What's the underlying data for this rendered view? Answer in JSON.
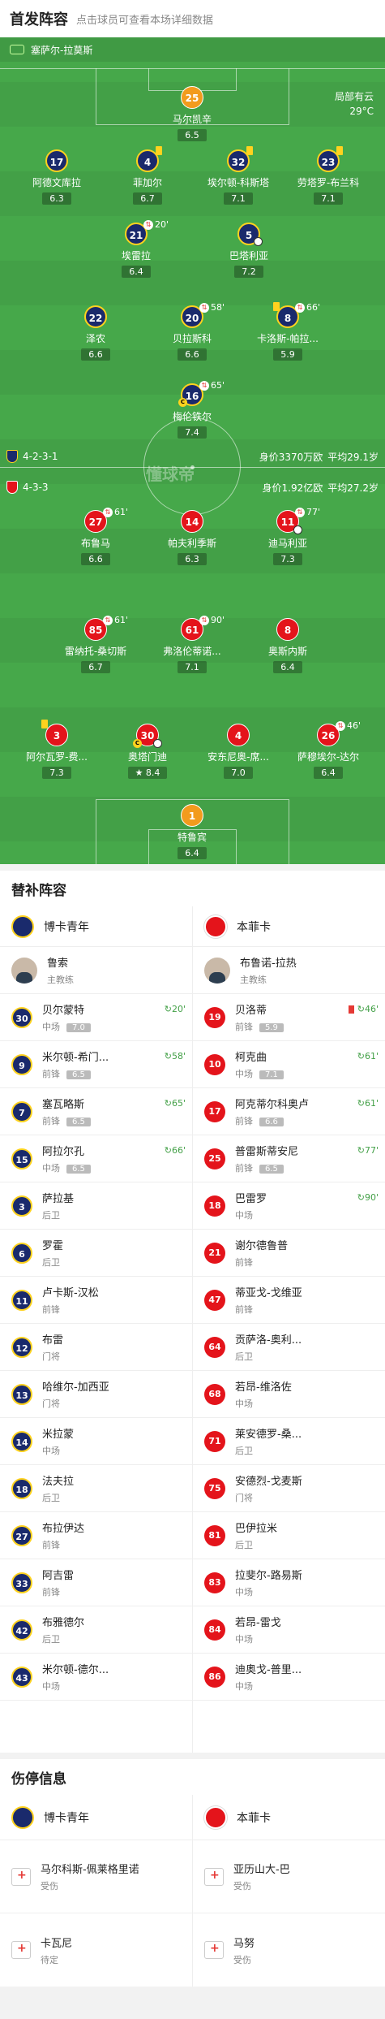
{
  "header": {
    "title": "首发阵容",
    "subtitle": "点击球员可查看本场详细数据"
  },
  "venue": "塞萨尔-拉莫斯",
  "weather": {
    "cond": "局部有云",
    "temp": "29°C"
  },
  "home": {
    "formation": "4-2-3-1",
    "value": "身价3370万欧",
    "age": "平均29.1岁"
  },
  "away": {
    "formation": "4-3-3",
    "value": "身价1.92亿欧",
    "age": "平均27.2岁"
  },
  "watermark": "懂球帝",
  "players": [
    {
      "num": "25",
      "name": "马尔凯辛",
      "rating": "6.5"
    },
    {
      "num": "17",
      "name": "阿德文库拉",
      "rating": "6.3"
    },
    {
      "num": "4",
      "name": "菲加尔",
      "rating": "6.7"
    },
    {
      "num": "32",
      "name": "埃尔顿-科斯塔",
      "rating": "7.1"
    },
    {
      "num": "23",
      "name": "劳塔罗-布兰科",
      "rating": "7.1"
    },
    {
      "num": "21",
      "name": "埃雷拉",
      "rating": "6.4",
      "sub": "20'"
    },
    {
      "num": "5",
      "name": "巴塔利亚",
      "rating": "7.2"
    },
    {
      "num": "22",
      "name": "泽农",
      "rating": "6.6"
    },
    {
      "num": "20",
      "name": "贝拉斯科",
      "rating": "6.6",
      "sub": "58'"
    },
    {
      "num": "8",
      "name": "卡洛斯-帕拉...",
      "rating": "5.9",
      "sub": "66'"
    },
    {
      "num": "16",
      "name": "梅伦铁尔",
      "rating": "7.4",
      "sub": "65'"
    },
    {
      "num": "27",
      "name": "布鲁马",
      "rating": "6.6",
      "sub": "61'"
    },
    {
      "num": "14",
      "name": "帕夫利季斯",
      "rating": "6.3"
    },
    {
      "num": "11",
      "name": "迪马利亚",
      "rating": "7.3",
      "sub": "77'"
    },
    {
      "num": "85",
      "name": "雷纳托-桑切斯",
      "rating": "6.7",
      "sub": "61'"
    },
    {
      "num": "61",
      "name": "弗洛伦蒂诺...",
      "rating": "7.1",
      "sub": "90'"
    },
    {
      "num": "8",
      "name": "奥斯内斯",
      "rating": "6.4"
    },
    {
      "num": "3",
      "name": "阿尔瓦罗-费...",
      "rating": "7.3"
    },
    {
      "num": "30",
      "name": "奥塔门迪",
      "rating": "8.4"
    },
    {
      "num": "4",
      "name": "安东尼奥-席...",
      "rating": "7.0"
    },
    {
      "num": "26",
      "name": "萨穆埃尔-达尔",
      "rating": "6.4",
      "sub": "46'"
    },
    {
      "num": "1",
      "name": "特鲁宾",
      "rating": "6.4"
    }
  ],
  "subs": {
    "title": "替补阵容",
    "home_team": "博卡青年",
    "away_team": "本菲卡",
    "home_coach": {
      "name": "鲁索",
      "role": "主教练"
    },
    "away_coach": {
      "name": "布鲁诺-拉热",
      "role": "主教练"
    },
    "rows": [
      [
        {
          "num": "30",
          "name": "贝尔蒙特",
          "pos": "中场",
          "rating": "7.0",
          "ev": "20'"
        },
        {
          "num": "19",
          "name": "贝洛蒂",
          "pos": "前锋",
          "rating": "5.9",
          "ev": "46'"
        }
      ],
      [
        {
          "num": "9",
          "name": "米尔顿-希门...",
          "pos": "前锋",
          "rating": "6.5",
          "ev": "58'"
        },
        {
          "num": "10",
          "name": "柯克曲",
          "pos": "中场",
          "rating": "7.1",
          "ev": "61'"
        }
      ],
      [
        {
          "num": "7",
          "name": "塞瓦略斯",
          "pos": "前锋",
          "rating": "6.5",
          "ev": "65'"
        },
        {
          "num": "17",
          "name": "阿克蒂尔科奥卢",
          "pos": "前锋",
          "rating": "6.6",
          "ev": "61'"
        }
      ],
      [
        {
          "num": "15",
          "name": "阿拉尔孔",
          "pos": "中场",
          "rating": "6.5",
          "ev": "66'"
        },
        {
          "num": "25",
          "name": "普雷斯蒂安尼",
          "pos": "前锋",
          "rating": "6.5",
          "ev": "77'"
        }
      ],
      [
        {
          "num": "3",
          "name": "萨拉基",
          "pos": "后卫"
        },
        {
          "num": "18",
          "name": "巴雷罗",
          "pos": "中场",
          "ev": "90'"
        }
      ],
      [
        {
          "num": "6",
          "name": "罗霍",
          "pos": "后卫"
        },
        {
          "num": "21",
          "name": "谢尔德鲁普",
          "pos": "前锋"
        }
      ],
      [
        {
          "num": "11",
          "name": "卢卡斯-汉松",
          "pos": "前锋"
        },
        {
          "num": "47",
          "name": "蒂亚戈-戈维亚",
          "pos": "前锋"
        }
      ],
      [
        {
          "num": "12",
          "name": "布雷",
          "pos": "门将"
        },
        {
          "num": "64",
          "name": "贡萨洛-奥利...",
          "pos": "后卫"
        }
      ],
      [
        {
          "num": "13",
          "name": "哈维尔-加西亚",
          "pos": "门将"
        },
        {
          "num": "68",
          "name": "若昂-维洛佐",
          "pos": "中场"
        }
      ],
      [
        {
          "num": "14",
          "name": "米拉蒙",
          "pos": "中场"
        },
        {
          "num": "71",
          "name": "莱安德罗-桑...",
          "pos": "后卫"
        }
      ],
      [
        {
          "num": "18",
          "name": "法夫拉",
          "pos": "后卫"
        },
        {
          "num": "75",
          "name": "安德烈-戈麦斯",
          "pos": "门将"
        }
      ],
      [
        {
          "num": "27",
          "name": "布拉伊达",
          "pos": "前锋"
        },
        {
          "num": "81",
          "name": "巴伊拉米",
          "pos": "后卫"
        }
      ],
      [
        {
          "num": "33",
          "name": "阿吉雷",
          "pos": "前锋"
        },
        {
          "num": "83",
          "name": "拉斐尔-路易斯",
          "pos": "中场"
        }
      ],
      [
        {
          "num": "42",
          "name": "布雅德尔",
          "pos": "后卫"
        },
        {
          "num": "84",
          "name": "若昂-雷戈",
          "pos": "中场"
        }
      ],
      [
        {
          "num": "43",
          "name": "米尔顿-德尔...",
          "pos": "中场"
        },
        {
          "num": "86",
          "name": "迪奥戈-普里...",
          "pos": "中场"
        }
      ]
    ]
  },
  "injuries": {
    "title": "伤停信息",
    "home_team": "博卡青年",
    "away_team": "本菲卡",
    "rows": [
      [
        {
          "name": "马尔科斯-佩莱格里诺",
          "status": "受伤"
        },
        {
          "name": "亚历山大-巴",
          "status": "受伤"
        }
      ],
      [
        {
          "name": "卡瓦尼",
          "status": "待定"
        },
        {
          "name": "马努",
          "status": "受伤"
        }
      ]
    ]
  }
}
